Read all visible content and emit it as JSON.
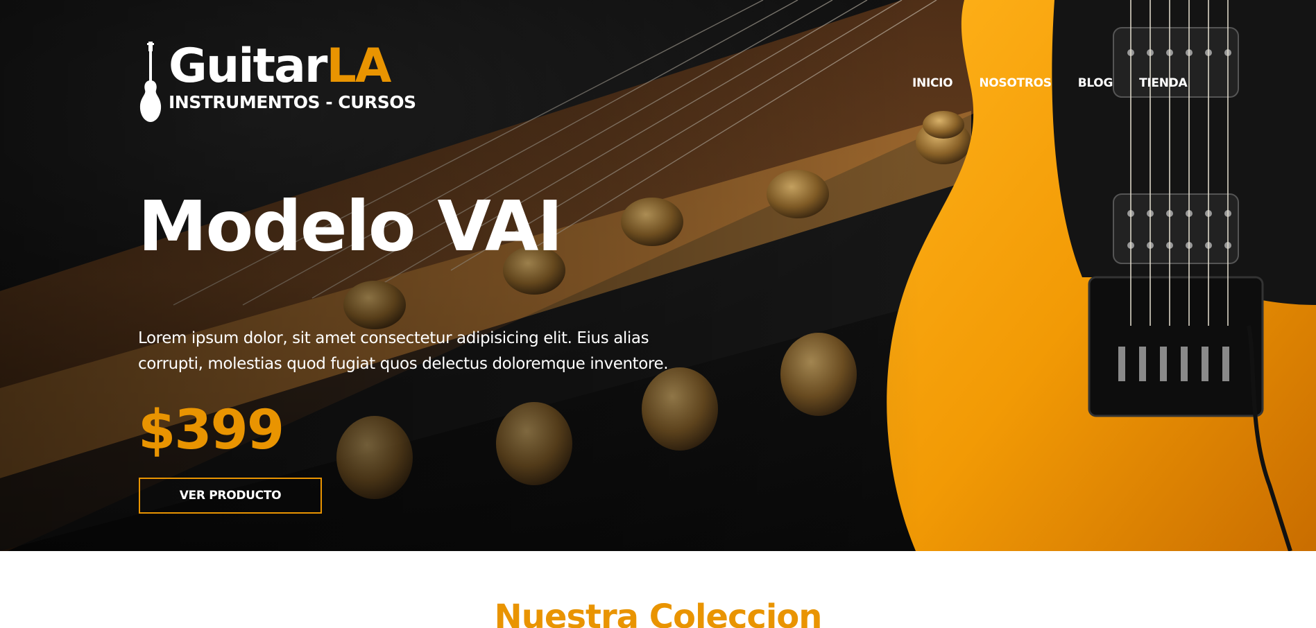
{
  "brand": {
    "name_primary": "Guitar",
    "name_accent": "LA",
    "tagline": "INSTRUMENTOS - CURSOS",
    "accent_color": "#e99401",
    "icon": "guitar-icon"
  },
  "nav": {
    "items": [
      {
        "label": "INICIO"
      },
      {
        "label": "NOSOTROS"
      },
      {
        "label": "BLOG"
      },
      {
        "label": "TIENDA"
      }
    ]
  },
  "hero": {
    "title": "Modelo VAI",
    "description": "Lorem ipsum dolor, sit amet consectetur adipisicing elit. Eius alias corrupti, molestias quod fugiat quos delectus doloremque inventore.",
    "price": "$399",
    "cta_label": "VER PRODUCTO",
    "background_image": "guitar-headstock-and-orange-electric-guitar-photo"
  },
  "collection": {
    "title": "Nuestra Coleccion"
  }
}
